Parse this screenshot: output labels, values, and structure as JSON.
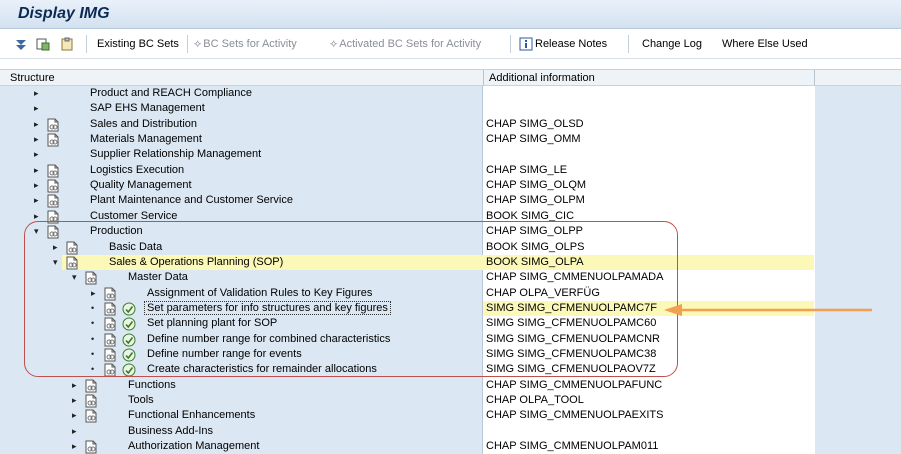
{
  "window": {
    "title": "Display IMG"
  },
  "toolbar": {
    "existing_bc_sets": "Existing BC Sets",
    "bc_sets_for_activity": "BC Sets for Activity",
    "activated_bc_sets": "Activated BC Sets for Activity",
    "release_notes": "Release Notes",
    "change_log": "Change Log",
    "where_else_used": "Where Else Used"
  },
  "columns": {
    "structure": "Structure",
    "additional": "Additional information"
  },
  "tree": [
    {
      "label": "Product and REACH Compliance",
      "info": ""
    },
    {
      "label": "SAP EHS Management",
      "info": ""
    },
    {
      "label": "Sales and Distribution",
      "info": "CHAP SIMG_OLSD"
    },
    {
      "label": "Materials Management",
      "info": "CHAP SIMG_OMM"
    },
    {
      "label": "Supplier Relationship Management",
      "info": ""
    },
    {
      "label": "Logistics Execution",
      "info": "CHAP SIMG_LE"
    },
    {
      "label": "Quality Management",
      "info": "CHAP SIMG_OLQM"
    },
    {
      "label": "Plant Maintenance and Customer Service",
      "info": "CHAP SIMG_OLPM"
    },
    {
      "label": "Customer Service",
      "info": "BOOK SIMG_CIC"
    },
    {
      "label": "Production",
      "info": "CHAP SIMG_OLPP"
    },
    {
      "label": "Basic Data",
      "info": "BOOK SIMG_OLPS"
    },
    {
      "label": "Sales & Operations Planning (SOP)",
      "info": "BOOK SIMG_OLPA"
    },
    {
      "label": "Master Data",
      "info": "CHAP SIMG_CMMENUOLPAMADA"
    },
    {
      "label": "Assignment of Validation Rules to Key Figures",
      "info": "CHAP OLPA_VERFÜG"
    },
    {
      "label": "Set parameters for info structures and key figures",
      "info": "SIMG SIMG_CFMENUOLPAMC7F"
    },
    {
      "label": "Set planning plant for SOP",
      "info": "SIMG SIMG_CFMENUOLPAMC60"
    },
    {
      "label": "Define number range for combined characteristics",
      "info": "SIMG SIMG_CFMENUOLPAMCNR"
    },
    {
      "label": "Define number range for events",
      "info": "SIMG SIMG_CFMENUOLPAMC38"
    },
    {
      "label": "Create characteristics for remainder allocations",
      "info": "SIMG SIMG_CFMENUOLPAOV7Z"
    },
    {
      "label": "Functions",
      "info": "CHAP SIMG_CMMENUOLPAFUNC"
    },
    {
      "label": "Tools",
      "info": "CHAP OLPA_TOOL"
    },
    {
      "label": "Functional Enhancements",
      "info": "CHAP SIMG_CMMENUOLPAEXITS"
    },
    {
      "label": "Business Add-Ins",
      "info": ""
    },
    {
      "label": "Authorization Management",
      "info": "CHAP SIMG_CMMENUOLPAM011"
    }
  ],
  "colors": {
    "highlight": "#fbf8b8",
    "callout": "#c0504d",
    "arrow": "#f0a050"
  }
}
